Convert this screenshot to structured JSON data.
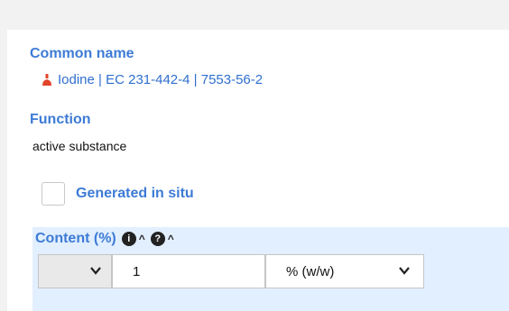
{
  "common_name": {
    "label": "Common name",
    "substance": "Iodine | EC 231-442-4 | 7553-56-2"
  },
  "function": {
    "label": "Function",
    "value": "active substance"
  },
  "generated_in_situ": {
    "label": "Generated in situ",
    "checked": false
  },
  "content": {
    "label": "Content (%)",
    "qualifier": "",
    "value": "1",
    "unit": "% (w/w)"
  },
  "colors": {
    "accent": "#3d7bd6",
    "content_band": "#e2efff",
    "flask_icon": "#e0442a"
  },
  "icons": [
    "flask-icon",
    "info-icon",
    "help-icon",
    "caret-up-icon",
    "chevron-down-icon"
  ]
}
